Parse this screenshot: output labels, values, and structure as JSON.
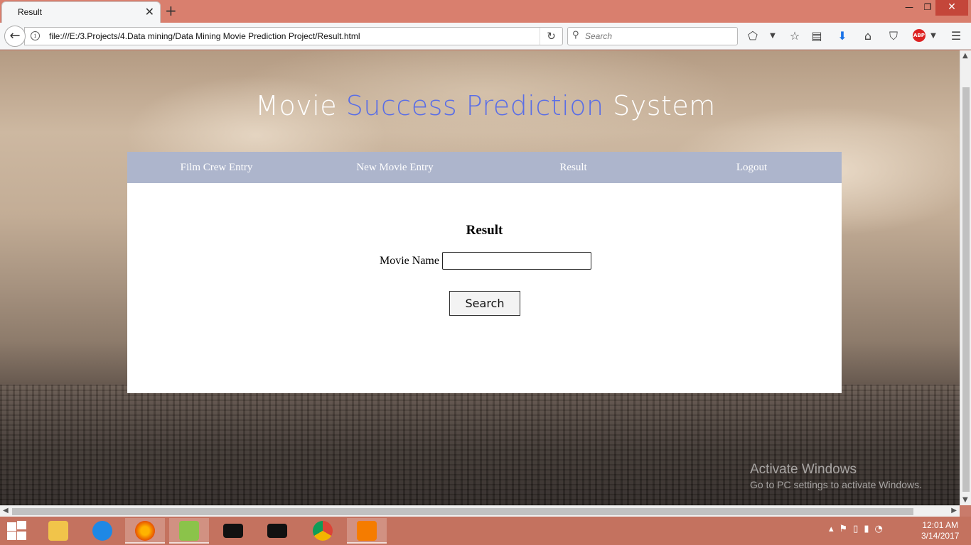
{
  "browser": {
    "tab_title": "Result",
    "url": "file:///E:/3.Projects/4.Data mining/Data Mining Movie Prediction Project/Result.html",
    "search_placeholder": "Search",
    "abp_label": "ABP"
  },
  "page": {
    "title_part1": "Movie ",
    "title_accent": "Success Prediction",
    "title_part2": " System",
    "nav": [
      {
        "label": "Film Crew Entry"
      },
      {
        "label": "New Movie Entry"
      },
      {
        "label": "Result"
      },
      {
        "label": "Logout"
      }
    ],
    "form": {
      "heading": "Result",
      "movie_name_label": "Movie Name",
      "movie_name_value": "",
      "search_button": "Search"
    },
    "watermark": {
      "line1": "Activate Windows",
      "line2": "Go to PC settings to activate Windows."
    }
  },
  "taskbar": {
    "apps": [
      "file-explorer-icon",
      "sync-icon",
      "firefox-icon",
      "notepad-plus-icon",
      "cmd-icon",
      "cmd-icon",
      "chrome-icon",
      "presentation-icon"
    ],
    "time": "12:01 AM",
    "date": "3/14/2017"
  },
  "colors": {
    "accent_title": "#5a6ee6",
    "nav_bar": "#adb5cc",
    "titlebar": "#d97f6e"
  }
}
